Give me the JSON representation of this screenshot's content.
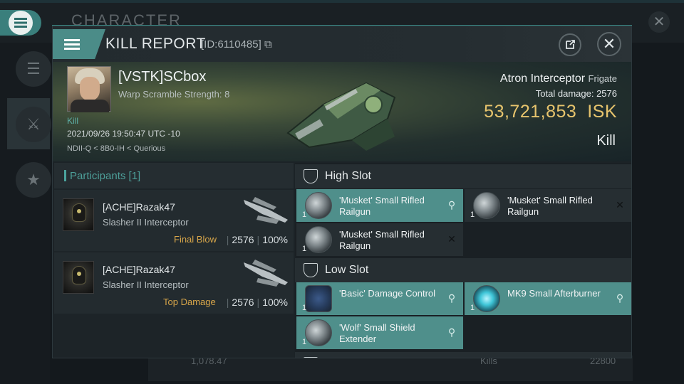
{
  "background": {
    "title": "CHARACTER",
    "bottom_left": "1,078.47",
    "bottom_right": "22800",
    "bottom_mid": "Kills"
  },
  "header": {
    "title": "KILL REPORT",
    "id": "[ID:6110485]"
  },
  "victim": {
    "name": "[VSTK]SCbox",
    "scram": "Warp Scramble Strength: 8",
    "kill_tag": "Kill",
    "date": "2021/09/26 19:50:47 UTC -10",
    "location": "NDII-Q < 8B0-IH < Querious",
    "ship": "Atron Interceptor",
    "ship_class": "Frigate",
    "total_damage_label": "Total damage:",
    "total_damage": "2576",
    "isk_value": "53,721,853",
    "isk_unit": "ISK",
    "result": "Kill"
  },
  "participants": {
    "title": "Participants",
    "count": "[1]",
    "rows": [
      {
        "name": "[ACHE]Razak47",
        "ship": "Slasher II Interceptor",
        "tag": "Final Blow",
        "damage": "2576",
        "percent": "100%"
      },
      {
        "name": "[ACHE]Razak47",
        "ship": "Slasher II Interceptor",
        "tag": "Top Damage",
        "damage": "2576",
        "percent": "100%"
      }
    ]
  },
  "slots": {
    "high": {
      "label": "High Slot",
      "items": [
        {
          "name": "'Musket' Small Rifled Railgun",
          "qty": "1",
          "state": "dropped"
        },
        {
          "name": "'Musket' Small Rifled Railgun",
          "qty": "1",
          "state": "destroyed"
        },
        {
          "name": "'Musket' Small Rifled Railgun",
          "qty": "1",
          "state": "destroyed"
        }
      ]
    },
    "low": {
      "label": "Low Slot",
      "items": [
        {
          "name": "'Basic' Damage Control",
          "qty": "1",
          "state": "dropped"
        },
        {
          "name": "MK9 Small Afterburner",
          "qty": "1",
          "state": "dropped"
        },
        {
          "name": "'Wolf' Small Shield Extender",
          "qty": "1",
          "state": "dropped"
        }
      ]
    }
  }
}
